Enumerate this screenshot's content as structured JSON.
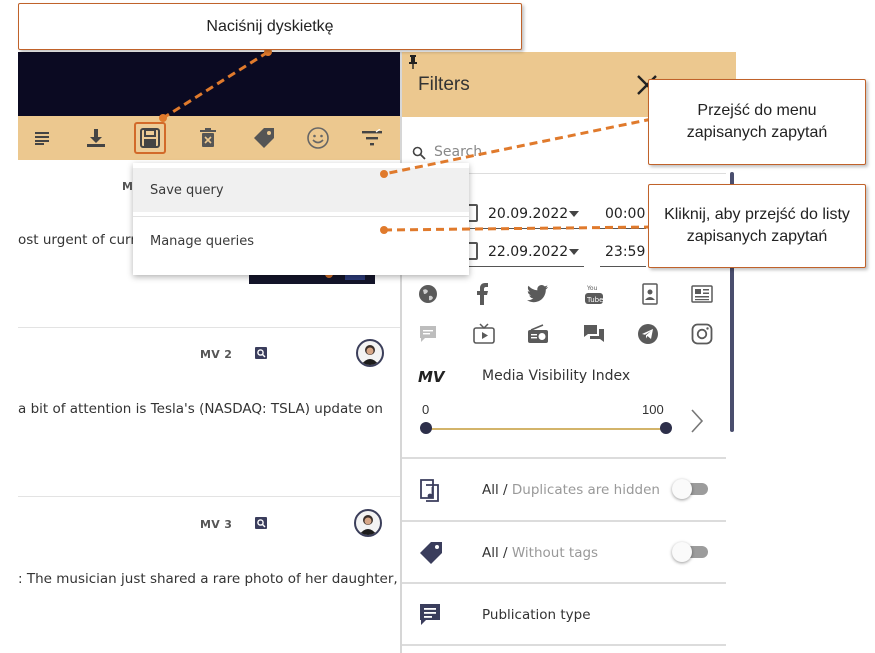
{
  "callouts": {
    "save_disk": "Naciśnij dyskietkę",
    "saved_menu": "Przejść do menu zapisanych zapytań",
    "saved_list": "Kliknij, aby przejść do listy zapisanych zapytań"
  },
  "toolbar": {
    "icons": [
      "list-icon",
      "download-icon",
      "floppy-disk-icon",
      "trash-icon",
      "tag-icon",
      "smiley-icon",
      "filter-icon"
    ]
  },
  "menu": {
    "items": [
      {
        "label": "Save query",
        "active": true
      },
      {
        "label": "Manage queries",
        "active": false
      }
    ]
  },
  "feed": {
    "cards": [
      {
        "mv": "MV",
        "text": "ost urgent of curr",
        "has_thumbnail": true
      },
      {
        "mv": "MV 2",
        "text": "a bit of attention is Tesla's (NASDAQ: TSLA) update on"
      },
      {
        "mv": "MV 3",
        "text": ": The musician just shared a rare photo of her daughter,"
      }
    ]
  },
  "filters": {
    "title": "Filters",
    "search_placeholder": "Search",
    "date_from": {
      "date": "20.09.2022",
      "time": "00:00"
    },
    "date_to": {
      "date": "22.09.2022",
      "time": "23:59"
    },
    "sources": [
      "globe-icon",
      "facebook-icon",
      "twitter-icon",
      "youtube-icon",
      "person-card-icon",
      "newspaper-icon",
      "chat-bubble-icon",
      "tv-icon",
      "radio-icon",
      "forum-icon",
      "telegram-icon",
      "instagram-icon"
    ],
    "mv": {
      "logo": "MV",
      "title": "Media Visibility Index",
      "min_label": "0",
      "max_label": "100",
      "range": [
        0,
        100
      ]
    },
    "rows": [
      {
        "icon": "duplicates-icon",
        "label_main": "All / ",
        "label_muted": "Duplicates are hidden",
        "toggle": false
      },
      {
        "icon": "tag-icon",
        "label_main": "All / ",
        "label_muted": "Without tags",
        "toggle": false
      },
      {
        "icon": "message-icon",
        "label_main": "Publication type",
        "label_muted": "",
        "toggle": null
      }
    ]
  },
  "colors": {
    "accent_tan": "#ecc88f",
    "header_dark": "#0b0a22",
    "callout_border": "#c0622a",
    "connector": "#e07a2c"
  }
}
